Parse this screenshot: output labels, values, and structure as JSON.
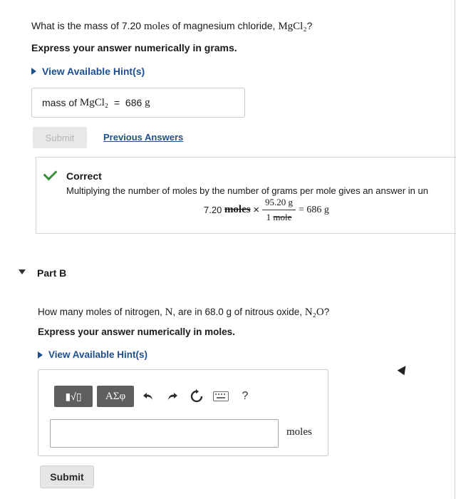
{
  "partA": {
    "question_prefix": "What is the mass of 7.20",
    "question_unit": "moles",
    "question_mid": "of magnesium chloride,",
    "question_formula": "MgCl₂",
    "question_suffix": "?",
    "instruction": "Express your answer numerically in grams.",
    "hint_label": "View Available Hint(s)",
    "answer_label": "mass of",
    "answer_formula": "MgCl₂",
    "answer_equals": "=",
    "answer_value": "686",
    "answer_unit": "g",
    "submit_label": "Submit",
    "previous_answers_label": "Previous Answers",
    "feedback": {
      "title": "Correct",
      "message": "Multiplying the number of moles by the number of grams per mole gives an answer in un",
      "calc_start": "7.20",
      "calc_moles": "moles",
      "calc_times": "×",
      "calc_num": "95.20 g",
      "calc_den_num": "1",
      "calc_den_unit": "mole",
      "calc_result": "= 686 g"
    }
  },
  "partB": {
    "label": "Part B",
    "question_prefix": "How many moles of nitrogen,",
    "question_symbol": "N",
    "question_mid": ", are in 68.0 g of nitrous oxide,",
    "question_formula": "N₂O",
    "question_suffix": "?",
    "instruction": "Express your answer numerically in moles.",
    "hint_label": "View Available Hint(s)",
    "toolbar": {
      "templates_glyph": "▮√▯",
      "greek_label": "ΑΣφ",
      "undo_icon": "undo-icon",
      "redo_icon": "redo-icon",
      "reset_icon": "reset-icon",
      "keyboard_icon": "keyboard-icon",
      "help_label": "?"
    },
    "input_value": "",
    "unit_label": "moles",
    "submit_label": "Submit"
  },
  "colors": {
    "link": "#1d4f8f",
    "correct_check": "#3a8f3a",
    "toolbar_dark": "#5e5e5e"
  }
}
